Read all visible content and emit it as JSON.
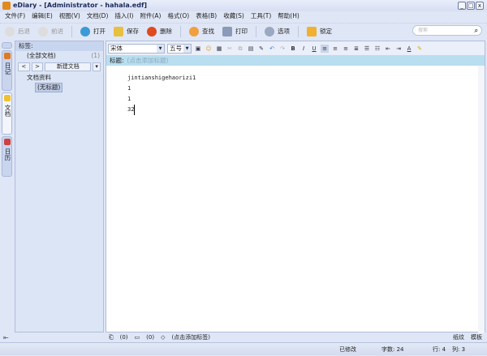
{
  "window": {
    "title": "eDiary - [Administrator - hahala.edf]",
    "minimize": "_",
    "maximize": "□",
    "close": "x"
  },
  "menu": [
    "文件(F)",
    "编辑(E)",
    "视图(V)",
    "文档(D)",
    "插入(I)",
    "附件(A)",
    "格式(O)",
    "表格(B)",
    "收藏(S)",
    "工具(T)",
    "帮助(H)"
  ],
  "toolbar": {
    "back": "后退",
    "forward": "前进",
    "open": "打开",
    "save": "保存",
    "delete": "删除",
    "find": "查找",
    "print": "打印",
    "options": "选项",
    "lock": "锁定"
  },
  "search": {
    "placeholder": "搜索"
  },
  "vtabs": {
    "diary": "日记",
    "docs": "文档",
    "calendar": "日历"
  },
  "left": {
    "tags_label": "标签:",
    "all_docs": "(全部文档)",
    "all_count": "(1)",
    "back": "<",
    "forward": ">",
    "new_doc": "新建文档",
    "tree_root": "文档资料",
    "tree_child": "(无标题)"
  },
  "format": {
    "font": "宋体",
    "size": "五号"
  },
  "editor": {
    "title_label": "标题:",
    "title_placeholder": "(点击添加标题)",
    "lines": [
      "jintianshigehaorizi1",
      "1",
      "1",
      "32"
    ]
  },
  "bottom": {
    "attach_count": "(0)",
    "comment_count": "(0)",
    "add_tag": "(点击添加标签)",
    "paper": "纸纹",
    "template": "模板"
  },
  "status": {
    "modified": "已修改",
    "wordcount": "字数: 24",
    "row": "行: 4",
    "col": "列: 3"
  }
}
